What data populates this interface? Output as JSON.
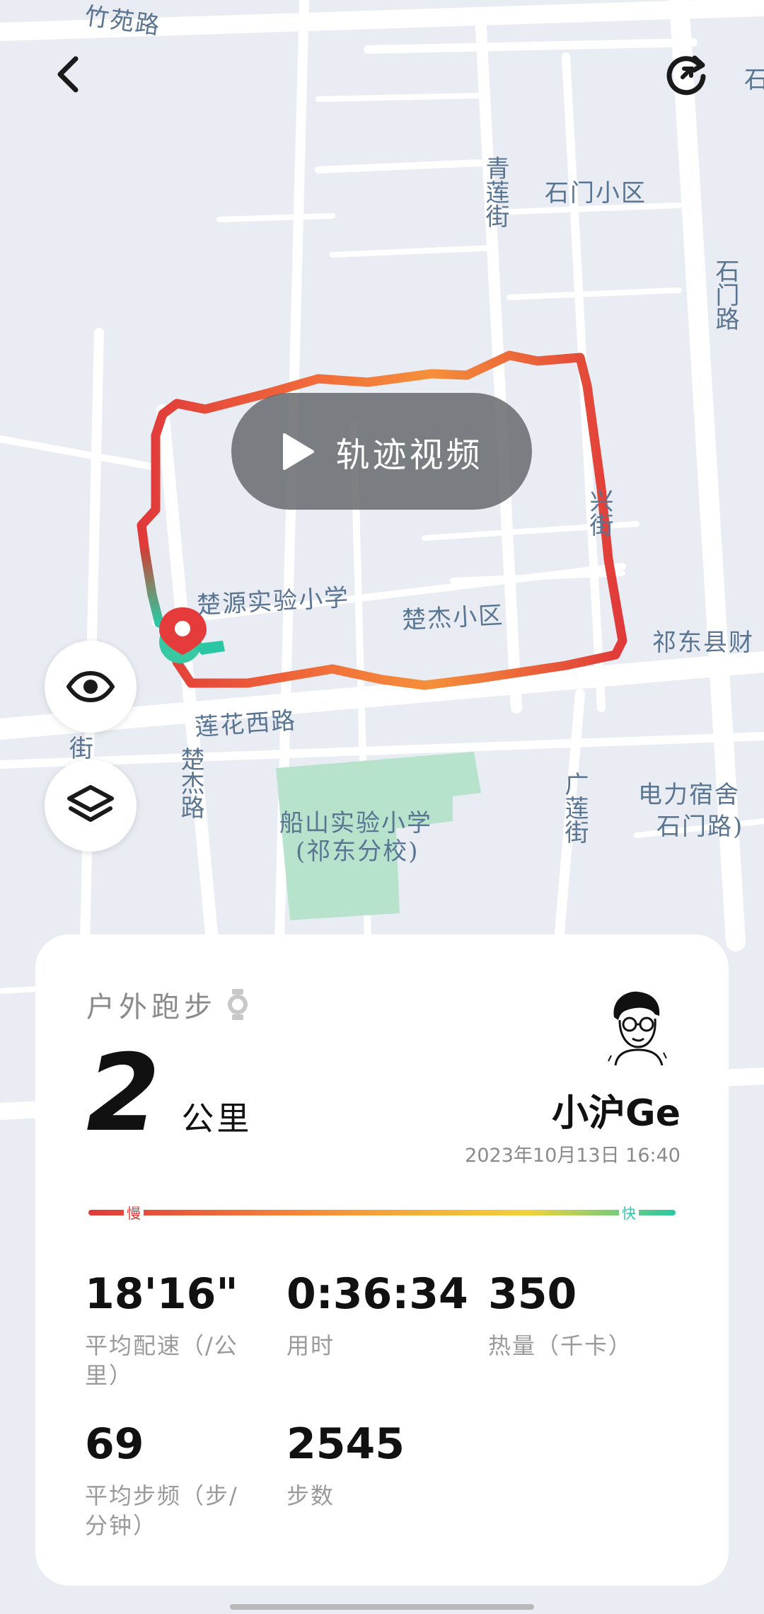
{
  "map": {
    "labels": [
      {
        "id": "zhuyuan-road",
        "text": "竹苑路"
      },
      {
        "id": "qinglian-street",
        "text": "青莲街"
      },
      {
        "id": "shimen-community",
        "text": "石门小区"
      },
      {
        "id": "shimen-road",
        "text": "石门路"
      },
      {
        "id": "shimen-road-edge",
        "text": "石"
      },
      {
        "id": "chuyuan-school",
        "text": "楚源实验小学"
      },
      {
        "id": "chujie-community",
        "text": "楚杰小区"
      },
      {
        "id": "lianhua-west-road",
        "text": "莲花西路"
      },
      {
        "id": "chujie-road",
        "text": "楚杰路"
      },
      {
        "id": "street-left",
        "text": "街"
      },
      {
        "id": "chuanshan-school",
        "text": "船山实验小学"
      },
      {
        "id": "qidong-branch",
        "text": "(祁东分校)"
      },
      {
        "id": "guanglian-street",
        "text": "广莲街"
      },
      {
        "id": "dianli-dorm",
        "text": "电力宿舍"
      },
      {
        "id": "dianli-dorm-2",
        "text": "石门路)"
      },
      {
        "id": "qidong-county",
        "text": "祁东县财"
      },
      {
        "id": "street-right",
        "text": "兴街"
      }
    ]
  },
  "controls": {
    "video_label": "轨迹视频"
  },
  "summary": {
    "activity_type": "户外跑步",
    "distance_value": "2",
    "distance_unit": "公里",
    "user_name": "小沪Ge",
    "datetime": "2023年10月13日 16:40",
    "slow_label": "慢",
    "fast_label": "快",
    "stats": [
      {
        "value": "18'16\"",
        "label": "平均配速（/公里）"
      },
      {
        "value": "0:36:34",
        "label": "用时"
      },
      {
        "value": "350",
        "label": "热量（千卡）"
      },
      {
        "value": "69",
        "label": "平均步频（步/分钟）"
      },
      {
        "value": "2545",
        "label": "步数"
      }
    ]
  },
  "colors": {
    "slow": "#e0393a",
    "mid": "#f5a43a",
    "fast": "#2bc7a4",
    "park": "#b7e3cc",
    "road": "#ffffff",
    "map_bg": "#e9edf3"
  }
}
